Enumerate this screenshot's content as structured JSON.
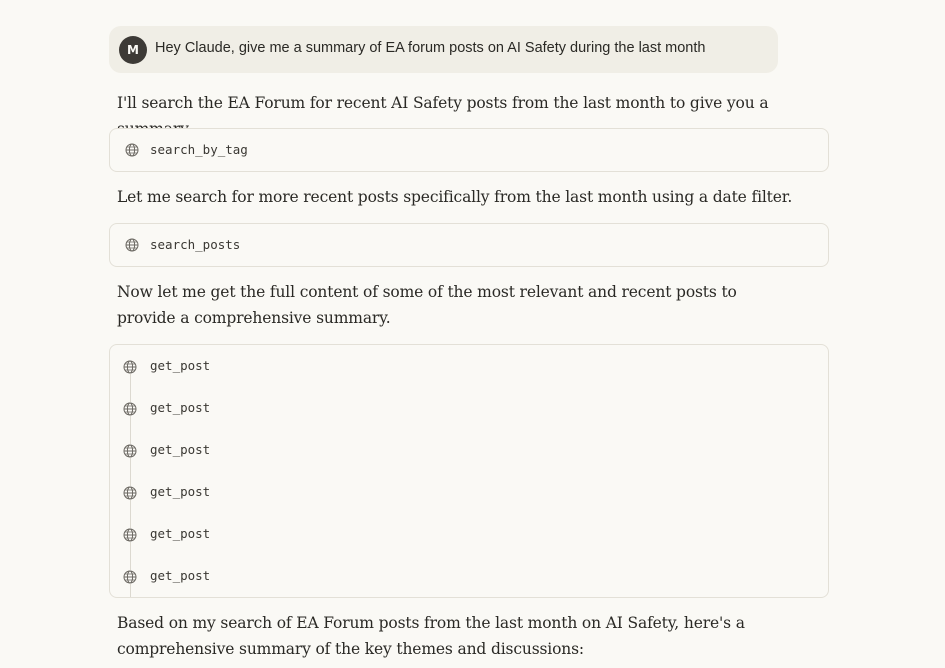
{
  "user_message": {
    "avatar_initial": "M",
    "text": "Hey Claude, give me a summary of EA forum posts on AI Safety during the last month"
  },
  "assistant": {
    "intro": "I'll search the EA Forum for recent AI Safety posts from the last month to give you a summary.",
    "tool_1": {
      "name": "search_by_tag",
      "icon": "globe-icon"
    },
    "followup": "Let me search for more recent posts specifically from the last month using a date filter.",
    "tool_2": {
      "name": "search_posts",
      "icon": "globe-icon"
    },
    "fetch_intro": "Now let me get the full content of some of the most relevant and recent posts to provide a comprehensive summary.",
    "tool_group": [
      {
        "name": "get_post",
        "icon": "globe-icon"
      },
      {
        "name": "get_post",
        "icon": "globe-icon"
      },
      {
        "name": "get_post",
        "icon": "globe-icon"
      },
      {
        "name": "get_post",
        "icon": "globe-icon"
      },
      {
        "name": "get_post",
        "icon": "globe-icon"
      },
      {
        "name": "get_post",
        "icon": "globe-icon"
      }
    ],
    "summary_intro": "Based on my search of EA Forum posts from the last month on AI Safety, here's a comprehensive summary of the key themes and discussions:"
  },
  "colors": {
    "background": "#faf9f5",
    "user_bubble": "#f0eee6",
    "avatar": "#3d3a36",
    "border": "#e3e0d7"
  }
}
